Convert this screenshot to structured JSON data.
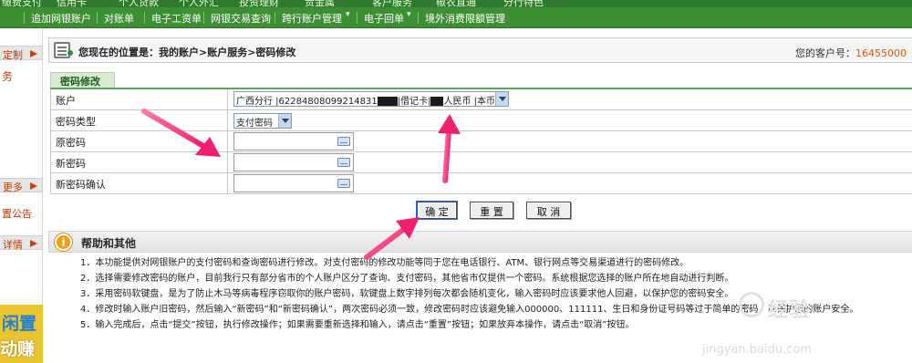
{
  "top_menu": {
    "row1": [
      "缴费支付",
      "信用卡",
      "个人贷款",
      "个人外汇",
      "投资理财",
      "贵金属",
      "客户服务",
      "椒农直通",
      "分行特色"
    ],
    "row2": [
      "追加网银账户",
      "对账单",
      "电子工资单",
      "网银交易查询",
      "跨行账户管理",
      "电子回单",
      "境外消费限额管理"
    ]
  },
  "sidebar": {
    "customize_btn": "定制",
    "service_label": "务",
    "more_btn": "更多",
    "notice_label": "置公告",
    "detail_btn": "详情",
    "promo_line1": "闲置",
    "promo_line2": "动赚"
  },
  "location": {
    "text": "您现在的位置是：我的账户>账户服务>密码修改",
    "customer_label": "您的客户号：",
    "customer_no": "16455000"
  },
  "tab": {
    "label": "密码修改"
  },
  "form": {
    "account_label": "账户",
    "account_value_a": "广西分行 |62284808099214831",
    "account_value_b": "|借记卡|",
    "account_value_c": "人民币 |本币",
    "pwd_type_label": "密码类型",
    "pwd_type_value": "支付密码",
    "old_pwd_label": "原密码",
    "new_pwd_label": "新密码",
    "confirm_pwd_label": "新密码确认"
  },
  "buttons": {
    "confirm": "确 定",
    "reset": "重 置",
    "cancel": "取 消"
  },
  "help": {
    "title": "帮助和其他",
    "items": [
      "1．本功能提供对网银账户的支付密码和查询密码进行修改。对支付密码的修改功能等同于您在电话银行、ATM、银行网点等交易渠道进行的密码修改。",
      "2．选择需要修改密码的账户，目前我行只有部分省市的个人账户区分了查询、支付密码，其他省市仅提供一个密码。系统根据您选择的账户所在地自动进行判断。",
      "3．采用密码软键盘，是为了防止木马等病毒程序窃取你的账户密码，软键盘上数字排列每次都会随机变化，输入密码时应该要求他人回避，以保护您的密码安全。",
      "4．修改时输入账户旧密码，然后输入“新密码”和“新密码确认”，两次密码必须一致，修改密码时应该避免输入000000、111111、生日和身份证号码等过于简单的密码，以保护您的账户安全。",
      "5．输入完成后，点击“提交”按钮，执行修改操作；如果需要重新选择和输入，请点击“重置”按钮；如果放弃本操作，请点击“取消”按钮。"
    ]
  },
  "watermark": {
    "brand": "经验",
    "url": "jingyan.baidu.com"
  },
  "colors": {
    "nav_green": "#3d8f34",
    "accent_orange": "#e05a12",
    "arrow_pink": "#f0307a"
  },
  "icons": [
    "keyboard-icon",
    "info-icon",
    "location-icon",
    "arrow-right-icon",
    "dropdown-icon"
  ]
}
